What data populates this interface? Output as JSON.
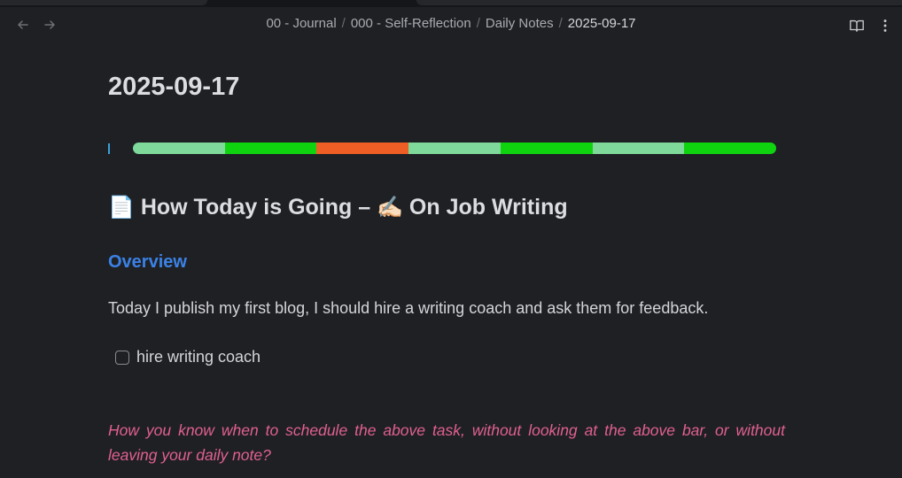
{
  "breadcrumb": {
    "items": [
      "00 - Journal",
      "000 - Self-Reflection",
      "Daily Notes",
      "2025-09-17"
    ],
    "separator": "/"
  },
  "note": {
    "title": "2025-09-17",
    "heading_icon": "📄",
    "heading_text": "How Today is Going – ",
    "heading_icon2": "✍🏻",
    "heading_text2": "On Job Writing",
    "section_title": "Overview",
    "paragraph": "Today I publish my first blog, I should hire a writing coach and ask them for feedback.",
    "task_label": "hire writing coach",
    "task_checked": false,
    "question": "How you know when to schedule the above task, without looking at the above bar, or without leaving your daily note?"
  },
  "progress": {
    "segments": [
      {
        "color": "#7ed99a"
      },
      {
        "color": "#10d310"
      },
      {
        "color": "#ef5f25"
      },
      {
        "color": "#7ed99a"
      },
      {
        "color": "#10d310"
      },
      {
        "color": "#7ed99a"
      },
      {
        "color": "#10d310"
      }
    ]
  },
  "icons": {
    "back": "arrow-left-icon",
    "forward": "arrow-right-icon",
    "reading_view": "book-open-icon",
    "more": "more-vertical-icon"
  },
  "colors": {
    "background": "#1f2024",
    "accent_heading": "#3b82e6",
    "question_text": "#e0608f"
  }
}
